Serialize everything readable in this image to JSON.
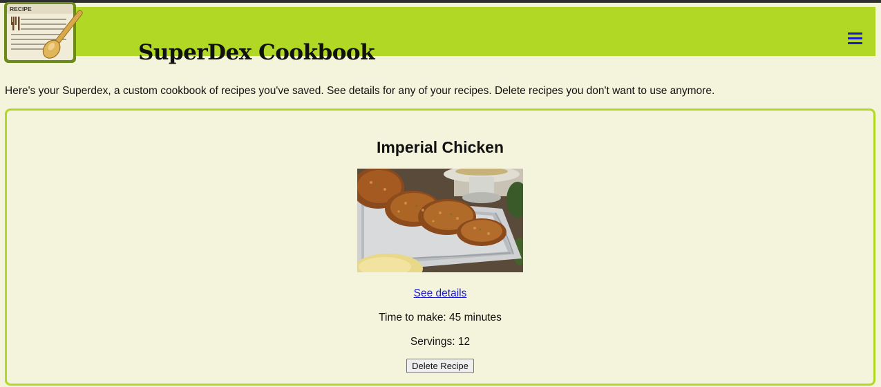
{
  "header": {
    "site_title": "SuperDex Cookbook",
    "logo_text": "RECIPE",
    "logo_icon": "recipe-card-spoon-icon",
    "menu_icon": "hamburger-menu-icon",
    "background_color": "#b0d824",
    "menu_color": "#1a1acc"
  },
  "intro": {
    "text": "Here's your Superdex, a custom cookbook of recipes you've saved. See details for any of your recipes. Delete recipes you don't want to use anymore."
  },
  "recipe": {
    "title": "Imperial Chicken",
    "image_alt": "Breaded chicken breasts on a silver platter",
    "details_link": "See details",
    "time_to_make": "Time to make: 45 minutes",
    "servings": "Servings: 12",
    "delete_label": "Delete Recipe"
  },
  "colors": {
    "page_background": "#f4f4dc",
    "accent": "#b0d824",
    "link": "#1a1acc"
  }
}
